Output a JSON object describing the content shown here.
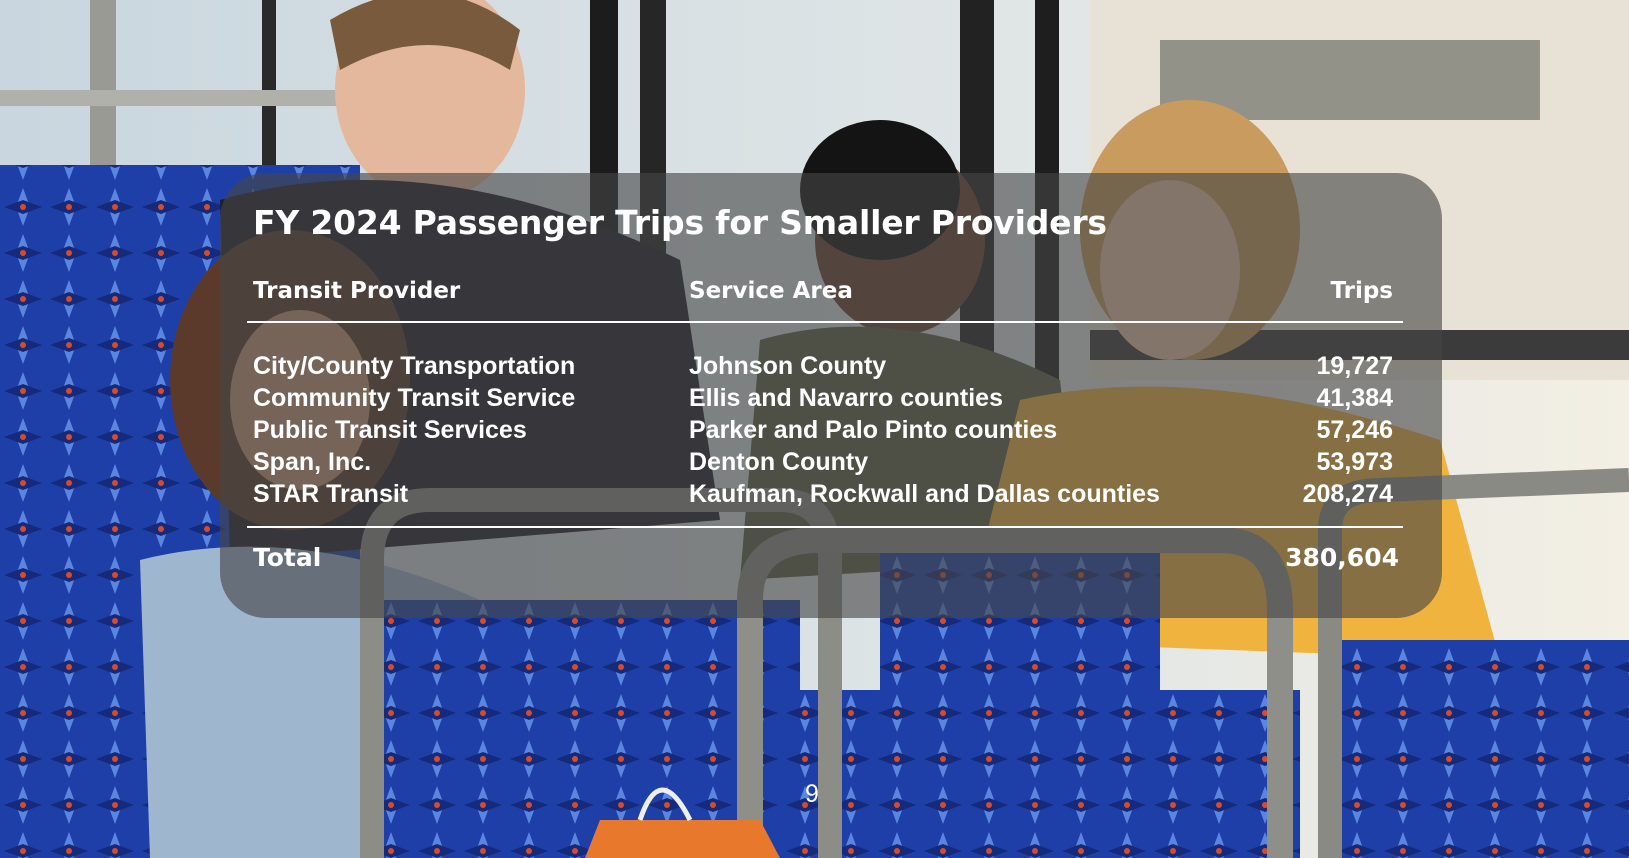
{
  "title": "FY 2024 Passenger Trips for Smaller Providers",
  "columns": {
    "provider": "Transit Provider",
    "area": "Service Area",
    "trips": "Trips"
  },
  "rows": [
    {
      "provider": "City/County Transportation",
      "area": "Johnson County",
      "trips": "19,727"
    },
    {
      "provider": "Community Transit Service",
      "area": "Ellis and Navarro counties",
      "trips": "41,384"
    },
    {
      "provider": "Public Transit Services",
      "area": "Parker and Palo Pinto counties",
      "trips": "57,246"
    },
    {
      "provider": "Span, Inc.",
      "area": "Denton County",
      "trips": "53,973"
    },
    {
      "provider": "STAR Transit",
      "area": "Kaufman, Rockwall and Dallas counties",
      "trips": "208,274"
    }
  ],
  "total": {
    "label": "Total",
    "trips": "380,604"
  },
  "page_number": "9",
  "colors": {
    "seat_blue": "#1f3fa8",
    "panel": "#464646",
    "text": "#ffffff"
  }
}
